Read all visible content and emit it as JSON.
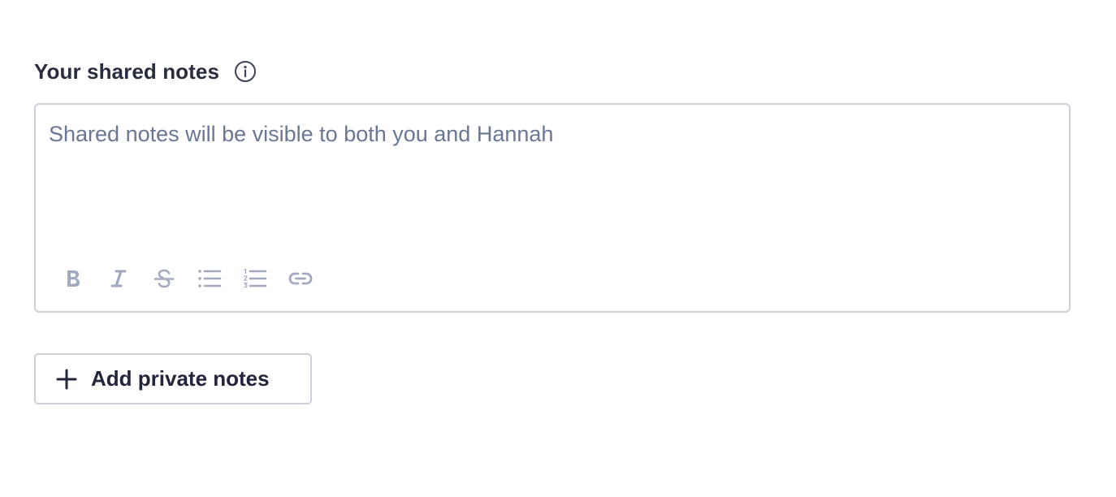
{
  "notes": {
    "title": "Your shared notes",
    "info_icon": "info-circle-icon",
    "editor": {
      "value": "",
      "placeholder": "Shared notes will be visible to both you and Hannah"
    },
    "toolbar": [
      {
        "name": "bold",
        "icon": "bold-icon"
      },
      {
        "name": "italic",
        "icon": "italic-icon"
      },
      {
        "name": "strikethrough",
        "icon": "strikethrough-icon"
      },
      {
        "name": "bulleted-list",
        "icon": "bulleted-list-icon"
      },
      {
        "name": "numbered-list",
        "icon": "numbered-list-icon"
      },
      {
        "name": "link",
        "icon": "link-icon"
      }
    ],
    "add_private_label": "Add private notes",
    "add_private_icon": "plus-icon"
  },
  "colors": {
    "text": "#23263b",
    "placeholder": "#6b7694",
    "icon_muted": "#a3a9be",
    "border": "#cdd0d9"
  }
}
